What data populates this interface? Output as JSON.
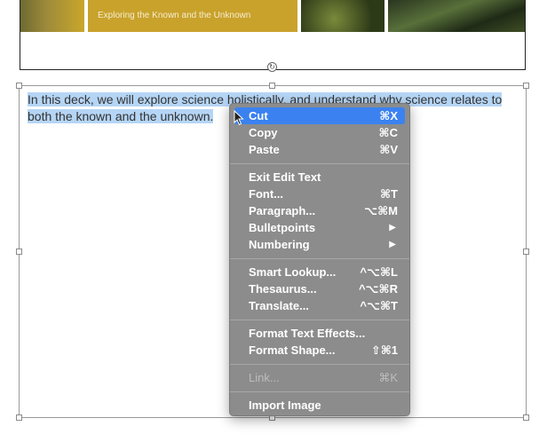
{
  "slide_header": {
    "subtitle": "Exploring the Known and the Unknown"
  },
  "textbox": {
    "selected_text": "In this deck, we will explore science holistically, and understand why science relates to both the known and the unknown."
  },
  "context_menu": {
    "items": [
      {
        "label": "Cut",
        "shortcut": "⌘X"
      },
      {
        "label": "Copy",
        "shortcut": "⌘C"
      },
      {
        "label": "Paste",
        "shortcut": "⌘V"
      },
      {
        "label": "Exit Edit Text",
        "shortcut": ""
      },
      {
        "label": "Font...",
        "shortcut": "⌘T"
      },
      {
        "label": "Paragraph...",
        "shortcut": "⌥⌘M"
      },
      {
        "label": "Bulletpoints",
        "shortcut": "▶"
      },
      {
        "label": "Numbering",
        "shortcut": "▶"
      },
      {
        "label": "Smart Lookup...",
        "shortcut": "^⌥⌘L"
      },
      {
        "label": "Thesaurus...",
        "shortcut": "^⌥⌘R"
      },
      {
        "label": "Translate...",
        "shortcut": "^⌥⌘T"
      },
      {
        "label": "Format Text Effects...",
        "shortcut": ""
      },
      {
        "label": "Format Shape...",
        "shortcut": "⇧⌘1"
      },
      {
        "label": "Link...",
        "shortcut": "⌘K"
      },
      {
        "label": "Import Image",
        "shortcut": ""
      }
    ]
  },
  "colors": {
    "menu_bg": "#8c8c8c",
    "highlight": "#3b82f0",
    "selection": "#b5d5f5"
  }
}
